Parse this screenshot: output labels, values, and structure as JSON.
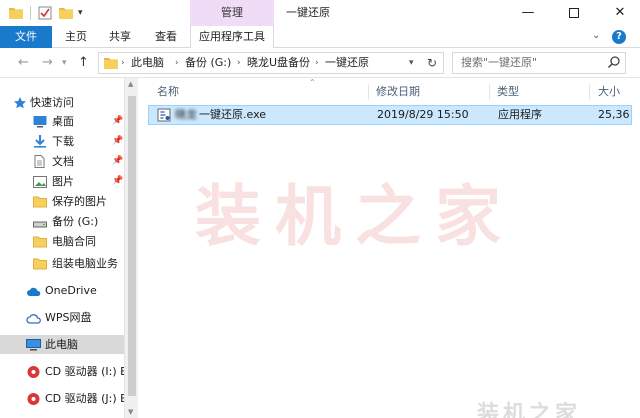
{
  "ribbon": {
    "contextual_tab": "管理",
    "window_title": "一键还原",
    "tabs": [
      "文件",
      "主页",
      "共享",
      "查看",
      "应用程序工具"
    ]
  },
  "address": {
    "breadcrumbs": [
      "此电脑",
      "备份 (G:)",
      "晓龙U盘备份",
      "一键还原"
    ],
    "search_placeholder": "搜索\"一键还原\""
  },
  "sidebar": {
    "items": [
      {
        "label": "快速访问",
        "icon": "star-icon"
      },
      {
        "label": "桌面",
        "icon": "desktop-icon",
        "pinned": true
      },
      {
        "label": "下载",
        "icon": "download-icon",
        "pinned": true
      },
      {
        "label": "文档",
        "icon": "document-icon",
        "pinned": true
      },
      {
        "label": "图片",
        "icon": "picture-icon",
        "pinned": true
      },
      {
        "label": "保存的图片",
        "icon": "folder-icon"
      },
      {
        "label": "备份 (G:)",
        "icon": "drive-icon"
      },
      {
        "label": "电脑合同",
        "icon": "folder-icon"
      },
      {
        "label": "组装电脑业务",
        "icon": "folder-icon"
      },
      {
        "label": "OneDrive",
        "icon": "cloud-icon"
      },
      {
        "label": "WPS网盘",
        "icon": "wps-cloud-icon"
      },
      {
        "label": "此电脑",
        "icon": "computer-icon",
        "selected": true
      },
      {
        "label": "CD 驱动器 (I:) BO",
        "icon": "cd-drive-icon"
      },
      {
        "label": "CD 驱动器 (J:) BO",
        "icon": "cd-drive-icon"
      }
    ]
  },
  "columns": [
    "名称",
    "修改日期",
    "类型",
    "大小"
  ],
  "files": [
    {
      "name_blurred": "晓龙",
      "name_visible": "一键还原.exe",
      "modified": "2019/8/29 15:50",
      "type": "应用程序",
      "size": "25,36"
    }
  ],
  "watermark": "装机之家",
  "watermark_small": "装机之家",
  "colors": {
    "accent": "#1979ca",
    "contextual_tab": "#f1dcf7",
    "selection": "#cce8ff",
    "selection_border": "#99d1ff",
    "header_text": "#4c607a"
  }
}
